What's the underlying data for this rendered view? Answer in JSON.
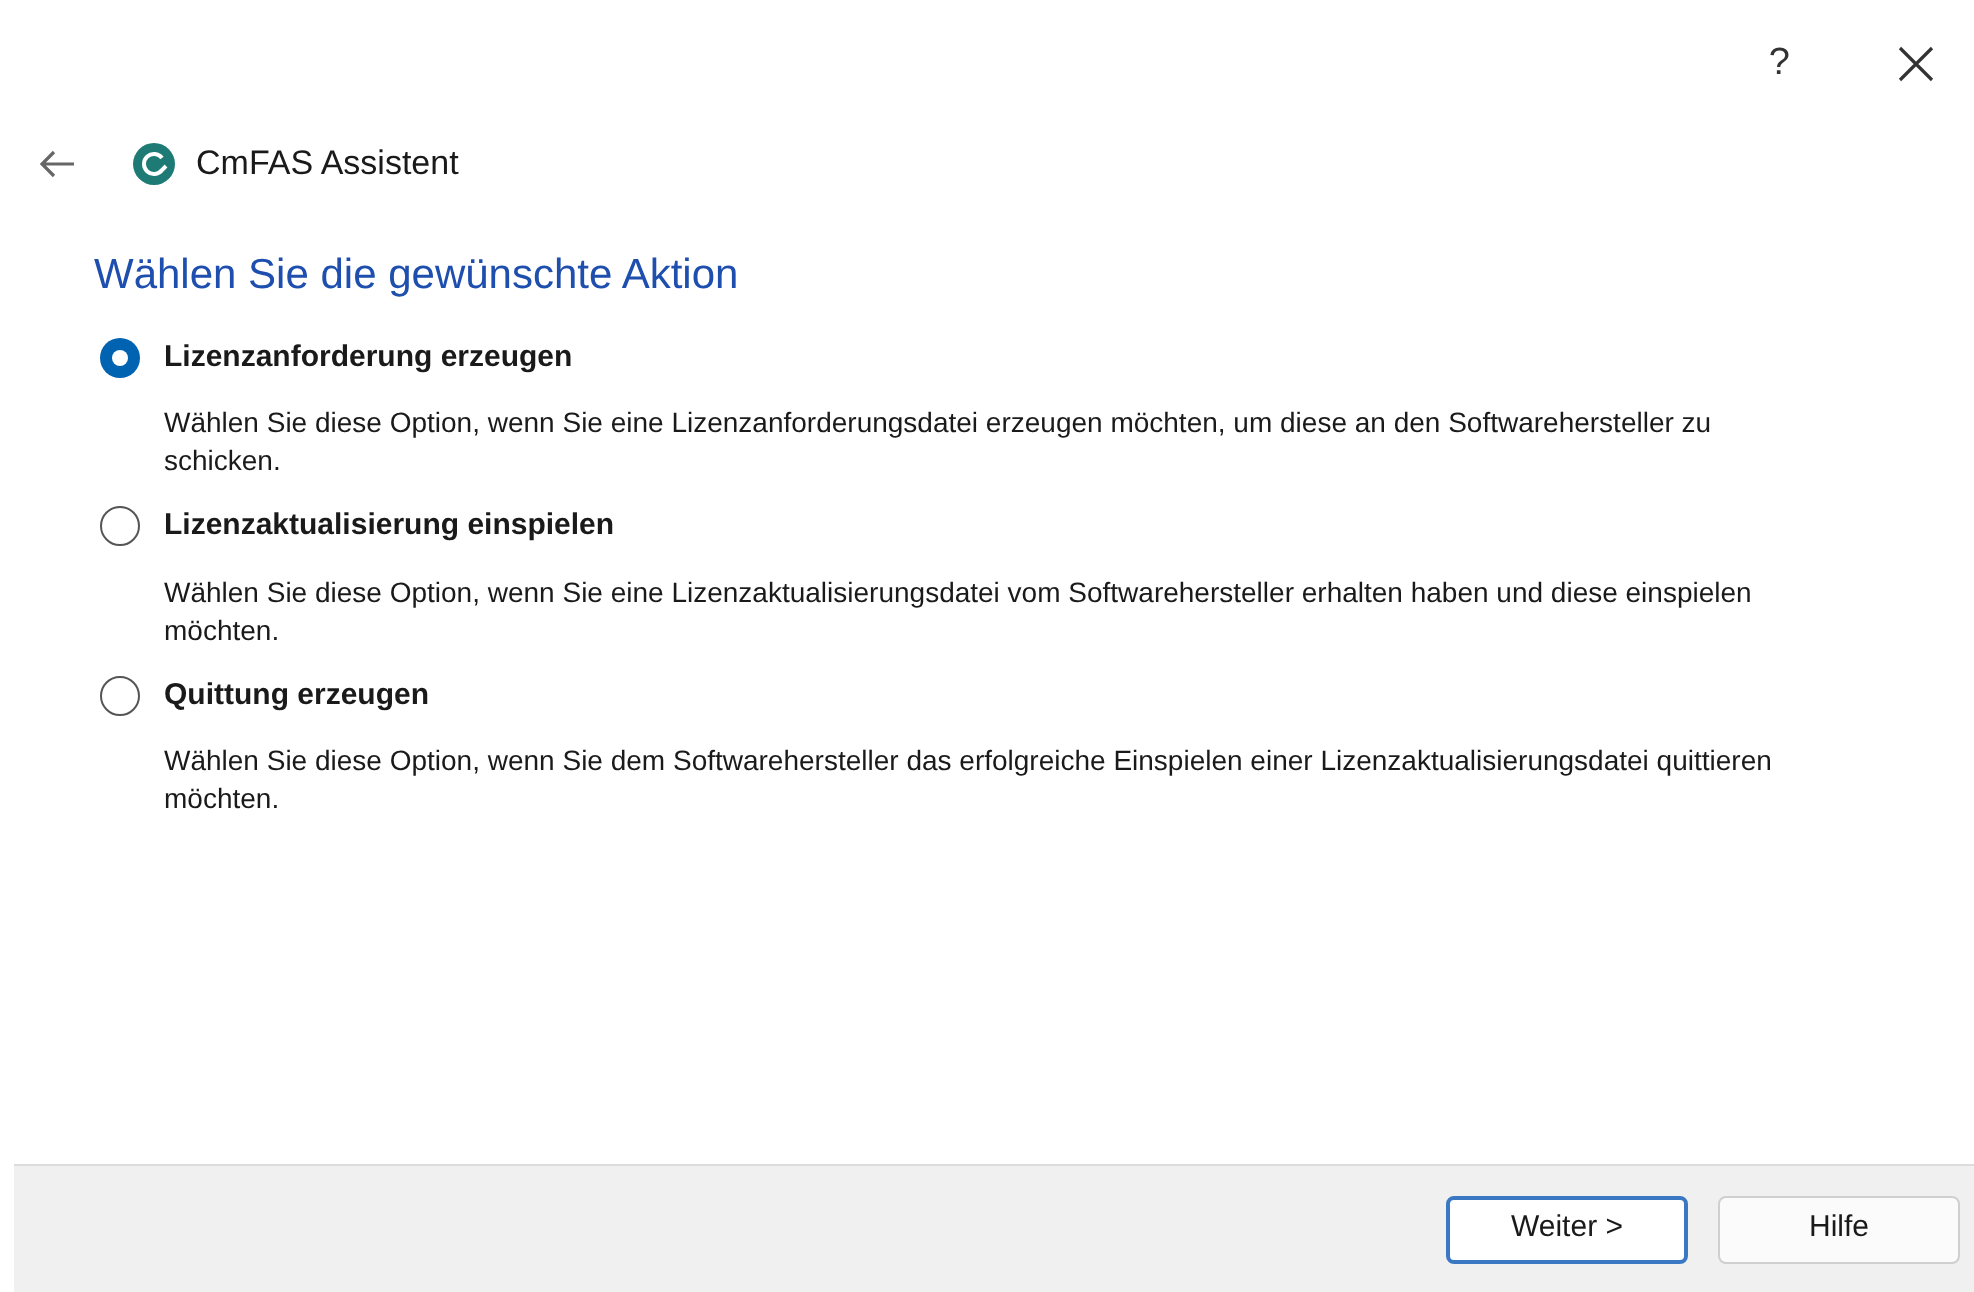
{
  "title_bar": {
    "help": "?"
  },
  "header": {
    "title": "CmFAS Assistent"
  },
  "heading": "Wählen Sie die gewünschte Aktion",
  "options": [
    {
      "label": "Lizenzanforderung erzeugen",
      "description": "Wählen Sie diese Option, wenn Sie eine Lizenzanforderungsdatei erzeugen möchten, um diese an den Softwarehersteller zu schicken.",
      "selected": true
    },
    {
      "label": "Lizenzaktualisierung einspielen",
      "description": "Wählen Sie diese Option, wenn Sie eine Lizenzaktualisierungsdatei vom Softwarehersteller erhalten haben und diese einspielen möchten.",
      "selected": false
    },
    {
      "label": "Quittung erzeugen",
      "description": "Wählen Sie diese Option, wenn Sie dem Softwarehersteller das erfolgreiche Einspielen einer Lizenzaktualisierungsdatei quittieren möchten.",
      "selected": false
    }
  ],
  "buttons": [
    {
      "label": "Weiter >",
      "default": true
    },
    {
      "label": "Hilfe",
      "default": false
    }
  ]
}
